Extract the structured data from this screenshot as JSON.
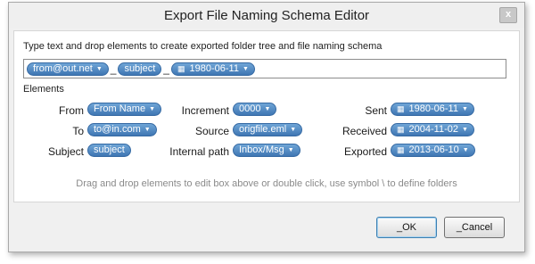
{
  "window": {
    "title": "Export File Naming Schema Editor",
    "close_glyph": "x"
  },
  "editor": {
    "instruction": "Type text and drop elements to create exported folder tree and file naming schema",
    "schema": {
      "from": "from@out.net",
      "separator_1": "_",
      "subject": "subject",
      "separator_2": "_",
      "date": "1980-06-11"
    },
    "elements_label": "Elements",
    "hint": "Drag and drop elements to edit box above or double click, use symbol \\ to define folders"
  },
  "elements": {
    "from": {
      "label": "From",
      "value": "From Name"
    },
    "to": {
      "label": "To",
      "value": "to@in.com"
    },
    "subject": {
      "label": "Subject",
      "value": "subject"
    },
    "increment": {
      "label": "Increment",
      "value": "0000"
    },
    "source": {
      "label": "Source",
      "value": "origfile.eml"
    },
    "internal_path": {
      "label": "Internal path",
      "value": "Inbox/Msg"
    },
    "sent": {
      "label": "Sent",
      "value": "1980-06-11"
    },
    "received": {
      "label": "Received",
      "value": "2004-11-02"
    },
    "exported": {
      "label": "Exported",
      "value": "2013-06-10"
    }
  },
  "buttons": {
    "ok": "_OK",
    "cancel": "_Cancel"
  },
  "icons": {
    "caret": "chevron-down-icon",
    "calendar": "calendar-icon"
  },
  "colors": {
    "pill_top": "#6fa5d6",
    "pill_bottom": "#3f76b3",
    "dialog_bg": "#f0f0f0",
    "ok_border": "#3c7fb1"
  }
}
